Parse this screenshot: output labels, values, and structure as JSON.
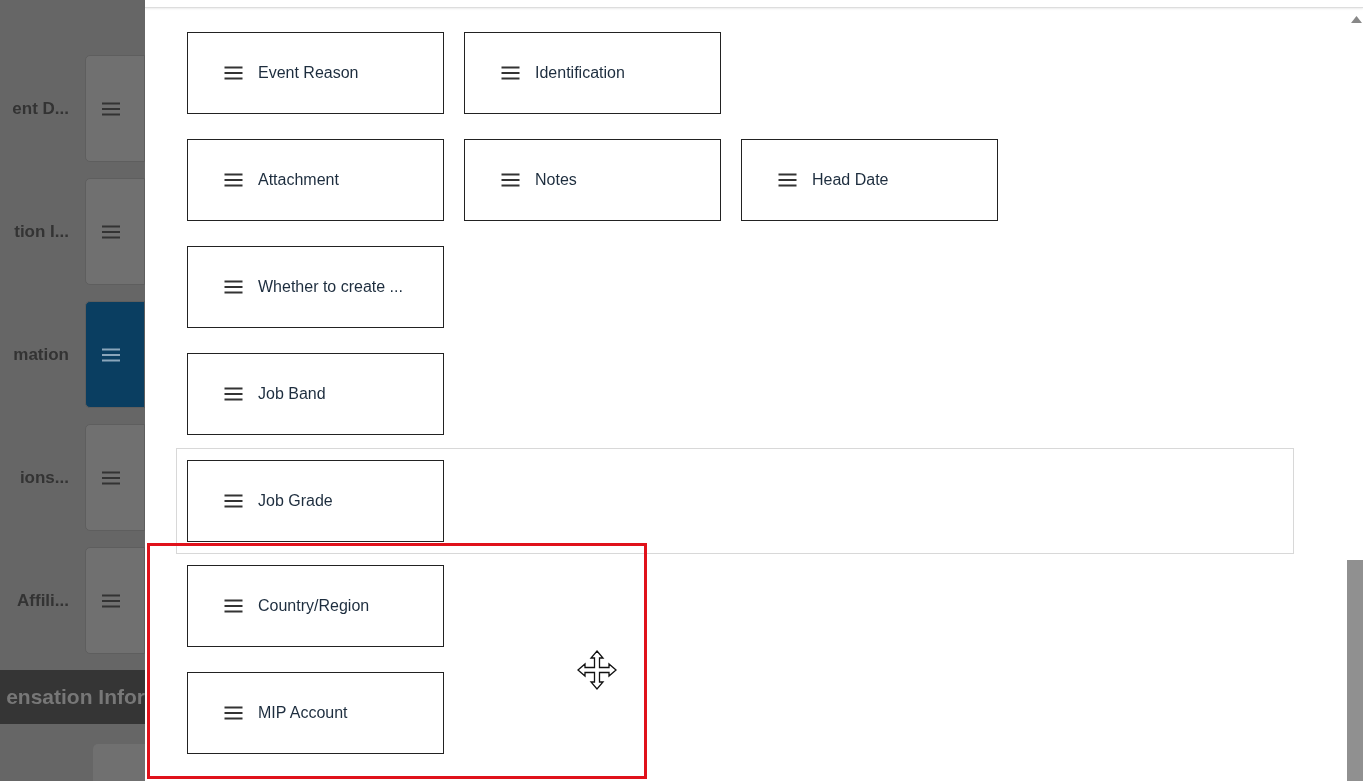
{
  "background": {
    "sections": [
      {
        "label": "ent D...",
        "selected": false
      },
      {
        "label": "tion I...",
        "selected": false
      },
      {
        "label": "mation",
        "selected": true
      },
      {
        "label": "ions...",
        "selected": false
      },
      {
        "label": " Affili...",
        "selected": false
      }
    ],
    "group_header": "ensation Infor"
  },
  "panel": {
    "rows": [
      {
        "drop_target": false,
        "fields": [
          "Event Reason",
          "Identification"
        ]
      },
      {
        "drop_target": false,
        "fields": [
          "Attachment",
          "Notes",
          "Head Date"
        ]
      },
      {
        "drop_target": false,
        "fields": [
          "Whether to create ..."
        ]
      },
      {
        "drop_target": false,
        "fields": [
          "Job Band"
        ]
      },
      {
        "drop_target": true,
        "fields": [
          "Job Grade"
        ]
      },
      {
        "drop_target": false,
        "fields": [
          "Country/Region"
        ]
      },
      {
        "drop_target": false,
        "fields": [
          "MIP Account"
        ]
      }
    ]
  }
}
